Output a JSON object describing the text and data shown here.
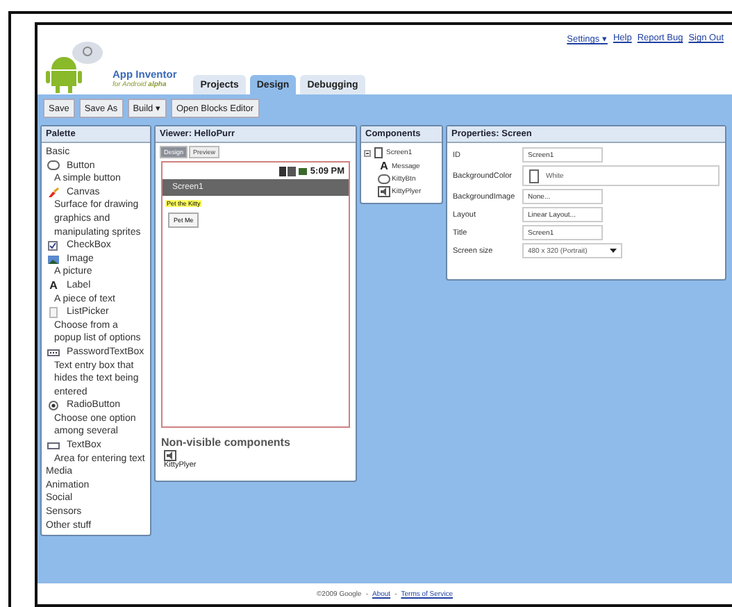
{
  "header_links": [
    "Settings ▾",
    "Help",
    "Report Bug",
    "Sign Out"
  ],
  "logo": {
    "title": "App Inventor",
    "subtitle": "for Android",
    "badge": "alpha"
  },
  "tabs": [
    {
      "label": "Projects",
      "selected": false
    },
    {
      "label": "Design",
      "selected": true
    },
    {
      "label": "Debugging",
      "selected": false
    }
  ],
  "toolbar": [
    "Save",
    "Save As",
    "Build ▾",
    "Open Blocks Editor"
  ],
  "palette": {
    "title": "Palette",
    "sections": [
      {
        "label": "Basic",
        "items": [
          {
            "kind": "button",
            "name": "Button",
            "description": "A simple button"
          },
          {
            "kind": "canvas",
            "name": "Canvas",
            "description": "Surface for drawing graphics and manipulating sprites"
          },
          {
            "kind": "checkbox",
            "name": "CheckBox"
          },
          {
            "kind": "image",
            "name": "Image",
            "description": "A picture"
          },
          {
            "kind": "label",
            "glyph": "A",
            "name": "Label",
            "description": "A piece of text"
          },
          {
            "kind": "listpicker",
            "name": "ListPicker",
            "description": "Choose from a popup list of options"
          },
          {
            "kind": "password",
            "name": "PasswordTextBox",
            "description": "Text entry box that hides the text being entered"
          },
          {
            "kind": "radio",
            "name": "RadioButton",
            "description": "Choose one option among several"
          },
          {
            "kind": "textbox",
            "name": "TextBox",
            "description": "Area for entering text"
          }
        ]
      },
      {
        "label": "Media"
      },
      {
        "label": "Animation"
      },
      {
        "label": "Social"
      },
      {
        "label": "Sensors"
      },
      {
        "label": "Other stuff"
      }
    ]
  },
  "viewer": {
    "title": "Viewer: HelloPurr",
    "tabs": [
      {
        "label": "Design",
        "selected": true
      },
      {
        "label": "Preview",
        "selected": false
      }
    ],
    "phone": {
      "time": "5:09 PM",
      "screen_title": "Screen1",
      "label": "Pet the Kitty",
      "button": "Pet Me"
    },
    "nonvisible_title": "Non-visible components",
    "nonvisible": [
      "KittyPlyer"
    ]
  },
  "components": {
    "title": "Components",
    "tree": [
      {
        "kind": "screen",
        "name": "Screen1",
        "expanded": true,
        "children": [
          {
            "kind": "label",
            "glyph": "A",
            "name": "Message"
          },
          {
            "kind": "button",
            "name": "KittyBtn"
          },
          {
            "kind": "sound",
            "name": "KittyPlyer"
          }
        ]
      }
    ]
  },
  "properties": {
    "title": "Properties: Screen",
    "rows": [
      {
        "kind": "text",
        "name": "ID",
        "value": "Screen1"
      },
      {
        "kind": "color",
        "name": "BackgroundColor",
        "value": "White",
        "color": "#ffffff"
      },
      {
        "kind": "text",
        "name": "BackgroundImage",
        "value": "None..."
      },
      {
        "kind": "text",
        "name": "Layout",
        "value": "Linear Layout..."
      },
      {
        "kind": "text",
        "name": "Title",
        "value": "Screen1"
      },
      {
        "kind": "select",
        "name": "Screen size",
        "value": "480 x 320 (Portrait)"
      }
    ]
  },
  "footer": [
    {
      "kind": "text",
      "text": "©2009 Google"
    },
    {
      "kind": "separator",
      "text": "-"
    },
    {
      "kind": "link",
      "text": "About"
    },
    {
      "kind": "separator",
      "text": "-"
    },
    {
      "kind": "link",
      "text": "Terms of Service"
    }
  ]
}
